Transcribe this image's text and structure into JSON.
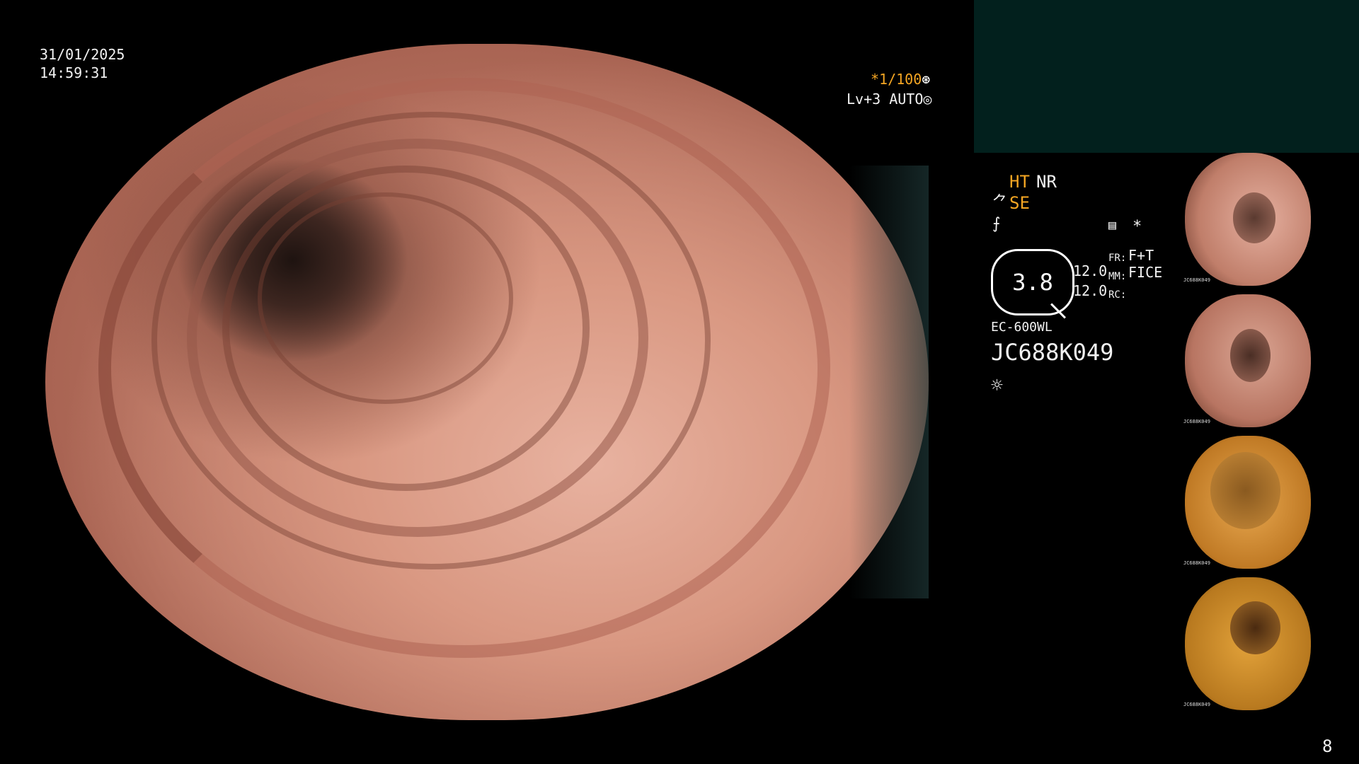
{
  "datetime": {
    "date": "31/01/2025",
    "time": "14:59:31"
  },
  "exposure": {
    "shutter": "*1/100",
    "shutter_icon": "aperture-icon",
    "level": "Lv+3 AUTO",
    "level_icon": "target-icon"
  },
  "settings": {
    "ht": "HT",
    "nr": "NR",
    "se": "SE",
    "scope_value": "3.8",
    "focus_a": "12.0",
    "focus_b": "12.0",
    "fr_label": "FR:",
    "fr_value": "F+T",
    "mm_label": "MM:",
    "mm_value": "FICE",
    "rc_label": "RC:",
    "asterisk": "*"
  },
  "device": {
    "model": "EC-600WL",
    "serial": "JC688K049"
  },
  "page_number": "8",
  "thumbnails": [
    {
      "label": "JC688K049",
      "tone": "#d79a86",
      "hole": "#6d4a3f"
    },
    {
      "label": "JC688K049",
      "tone": "#c98a74",
      "hole": "#5a3a30"
    },
    {
      "label": "JC688K049",
      "tone": "#d98f3a",
      "hole": "#7a4a1a"
    },
    {
      "label": "JC688K049",
      "tone": "#c98428",
      "hole": "#5f3a12"
    }
  ]
}
